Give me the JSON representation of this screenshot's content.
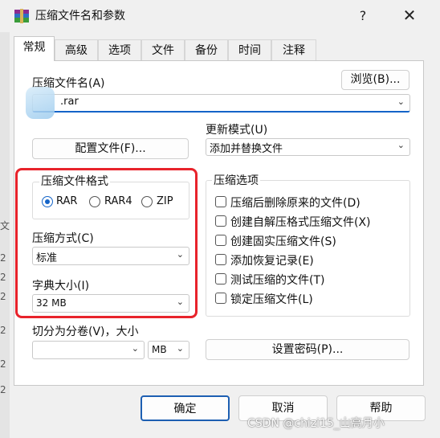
{
  "window": {
    "title": "压缩文件名和参数",
    "help_glyph": "?",
    "close_glyph": "✕"
  },
  "tabs": [
    "常规",
    "高级",
    "选项",
    "文件",
    "备份",
    "时间",
    "注释"
  ],
  "general": {
    "archive_name_label": "压缩文件名(A)",
    "archive_name_value": ".rar",
    "browse_button": "浏览(B)...",
    "update_mode_label": "更新模式(U)",
    "update_mode_value": "添加并替换文件",
    "profiles_button": "配置文件(F)...",
    "format_group_label": "压缩文件格式",
    "formats": [
      {
        "label": "RAR",
        "selected": true
      },
      {
        "label": "RAR4",
        "selected": false
      },
      {
        "label": "ZIP",
        "selected": false
      }
    ],
    "method_label": "压缩方式(C)",
    "method_value": "标准",
    "dict_label": "字典大小(I)",
    "dict_value": "32 MB",
    "split_label": "切分为分卷(V)，大小",
    "split_value": "",
    "split_unit": "MB",
    "options_group_label": "压缩选项",
    "options": [
      {
        "label": "压缩后删除原来的文件(D)",
        "checked": false
      },
      {
        "label": "创建自解压格式压缩文件(X)",
        "checked": false
      },
      {
        "label": "创建固实压缩文件(S)",
        "checked": false
      },
      {
        "label": "添加恢复记录(E)",
        "checked": false
      },
      {
        "label": "测试压缩的文件(T)",
        "checked": false
      },
      {
        "label": "锁定压缩文件(L)",
        "checked": false
      }
    ],
    "password_button": "设置密码(P)..."
  },
  "buttons": {
    "ok": "确定",
    "cancel": "取消",
    "help": "帮助"
  },
  "background_fragments": [
    "文",
    "2",
    "2",
    "2",
    "2",
    "2",
    "2"
  ],
  "watermark": "CSDN @chizi15_山高月小",
  "colors": {
    "accent": "#1464c8",
    "highlight_box": "#e8232b"
  },
  "icons": {
    "app": "winrar-icon",
    "dropdown": "chevron-down-icon"
  }
}
